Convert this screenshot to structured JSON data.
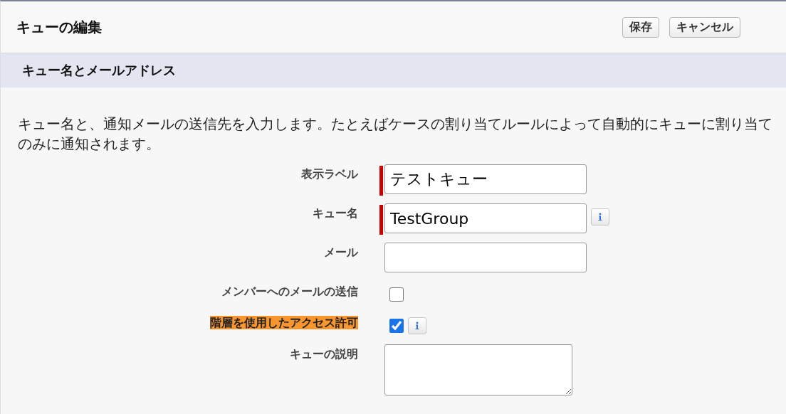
{
  "header": {
    "title": "キューの編集",
    "buttons": [
      "保存",
      "キャンセル"
    ]
  },
  "section": {
    "title": "キュー名とメールアドレス",
    "description": [
      "キュー名と、通知メールの送信先を入力します。たとえばケースの割り当てルールによって自動的にキューに割り当て",
      "のみに通知されます。"
    ]
  },
  "fields": [
    {
      "kind": "text",
      "label": "表示ラベル",
      "value": "テストキュー",
      "required": true,
      "info": false,
      "highlighted": false
    },
    {
      "kind": "text",
      "label": "キュー名",
      "value": "TestGroup",
      "required": true,
      "info": true,
      "highlighted": false
    },
    {
      "kind": "text",
      "label": "メール",
      "required": false,
      "info": false,
      "highlighted": false
    },
    {
      "kind": "checkbox",
      "label": "メンバーへのメールの送信",
      "checked": false,
      "info": false,
      "highlighted": false
    },
    {
      "kind": "checkbox",
      "label": "階層を使用したアクセス許可",
      "checked": true,
      "info": true,
      "highlighted": true
    },
    {
      "kind": "textarea",
      "label": "キューの説明",
      "info": false,
      "highlighted": false
    }
  ]
}
